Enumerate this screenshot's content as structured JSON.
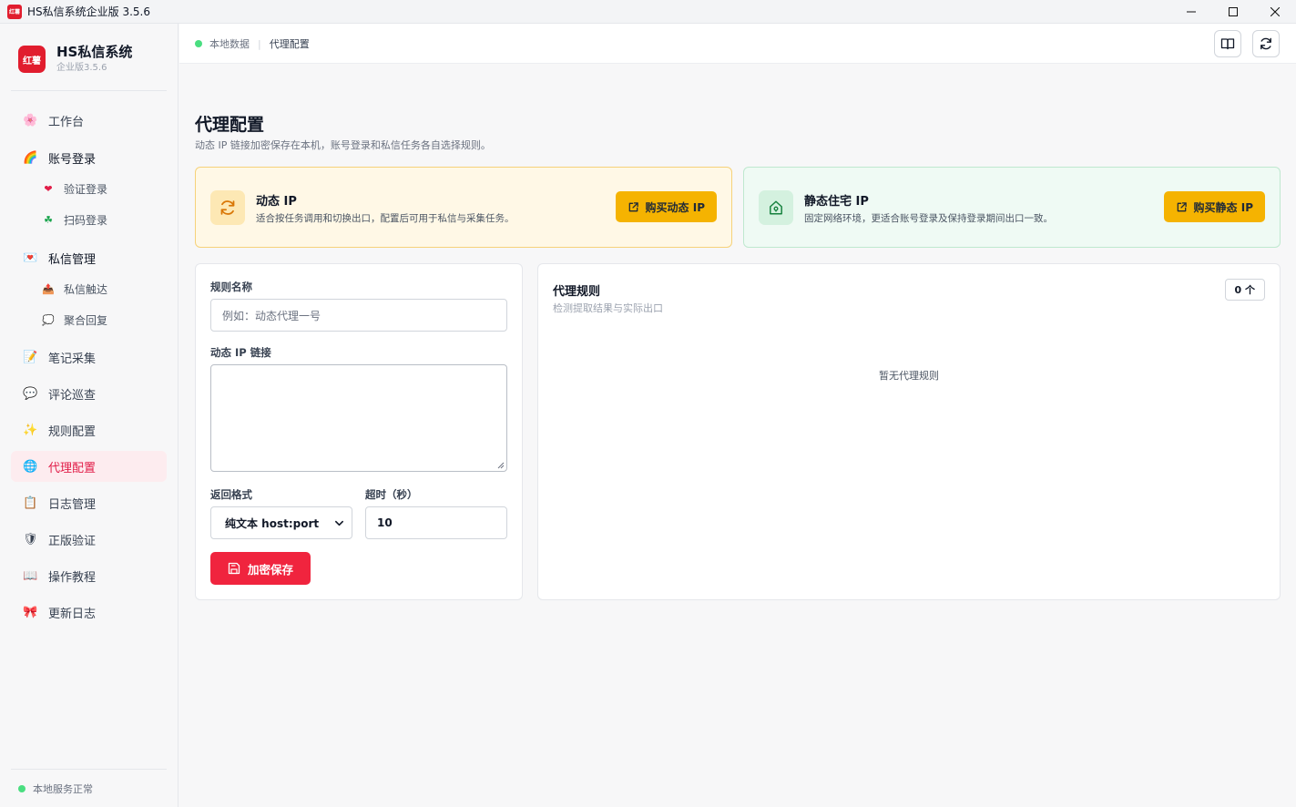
{
  "window": {
    "app_icon_text": "红薯",
    "title": "HS私信系统企业版 3.5.6"
  },
  "brand": {
    "logo_text": "红薯",
    "name": "HS私信系统",
    "version": "企业版3.5.6"
  },
  "sidebar": {
    "workbench": "工作台",
    "account_login": "账号登录",
    "verify_login": "验证登录",
    "qr_login": "扫码登录",
    "dm_manage": "私信管理",
    "dm_reach": "私信触达",
    "aggregate_reply": "聚合回复",
    "note_collect": "笔记采集",
    "comment_patrol": "评论巡查",
    "rule_config": "规则配置",
    "proxy_config": "代理配置",
    "log_manage": "日志管理",
    "license_verify": "正版验证",
    "tutorial": "操作教程",
    "changelog": "更新日志",
    "service_status": "本地服务正常"
  },
  "breadcrumb": {
    "source": "本地数据",
    "current": "代理配置"
  },
  "page": {
    "title": "代理配置",
    "description": "动态 IP 链接加密保存在本机，账号登录和私信任务各自选择规则。"
  },
  "dynamic_card": {
    "title": "动态 IP",
    "description": "适合按任务调用和切换出口，配置后可用于私信与采集任务。",
    "button": "购买动态 IP"
  },
  "static_card": {
    "title": "静态住宅 IP",
    "description": "固定网络环境，更适合账号登录及保持登录期间出口一致。",
    "button": "购买静态 IP"
  },
  "form": {
    "rule_name_label": "规则名称",
    "rule_name_placeholder": "例如：动态代理一号",
    "link_label": "动态 IP 链接",
    "format_label": "返回格式",
    "format_value": "纯文本 host:port",
    "timeout_label": "超时（秒）",
    "timeout_value": "10",
    "save_button": "加密保存"
  },
  "rules_panel": {
    "title": "代理规则",
    "subtitle": "检测提取结果与实际出口",
    "count": "0 个",
    "empty": "暂无代理规则"
  },
  "colors": {
    "brand_red": "#e11d2e",
    "save_red": "#f0243e",
    "buy_yellow": "#f5b301",
    "active_nav": "#e11d48",
    "status_green": "#4ade80"
  }
}
